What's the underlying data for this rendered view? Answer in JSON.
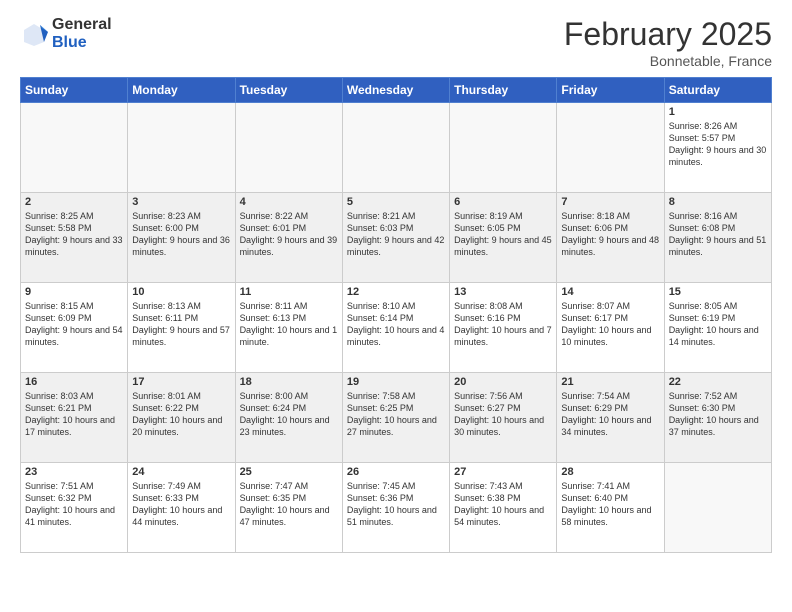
{
  "header": {
    "logo_general": "General",
    "logo_blue": "Blue",
    "month_title": "February 2025",
    "location": "Bonnetable, France"
  },
  "days_of_week": [
    "Sunday",
    "Monday",
    "Tuesday",
    "Wednesday",
    "Thursday",
    "Friday",
    "Saturday"
  ],
  "weeks": [
    [
      {
        "day": "",
        "info": ""
      },
      {
        "day": "",
        "info": ""
      },
      {
        "day": "",
        "info": ""
      },
      {
        "day": "",
        "info": ""
      },
      {
        "day": "",
        "info": ""
      },
      {
        "day": "",
        "info": ""
      },
      {
        "day": "1",
        "info": "Sunrise: 8:26 AM\nSunset: 5:57 PM\nDaylight: 9 hours and 30 minutes."
      }
    ],
    [
      {
        "day": "2",
        "info": "Sunrise: 8:25 AM\nSunset: 5:58 PM\nDaylight: 9 hours and 33 minutes."
      },
      {
        "day": "3",
        "info": "Sunrise: 8:23 AM\nSunset: 6:00 PM\nDaylight: 9 hours and 36 minutes."
      },
      {
        "day": "4",
        "info": "Sunrise: 8:22 AM\nSunset: 6:01 PM\nDaylight: 9 hours and 39 minutes."
      },
      {
        "day": "5",
        "info": "Sunrise: 8:21 AM\nSunset: 6:03 PM\nDaylight: 9 hours and 42 minutes."
      },
      {
        "day": "6",
        "info": "Sunrise: 8:19 AM\nSunset: 6:05 PM\nDaylight: 9 hours and 45 minutes."
      },
      {
        "day": "7",
        "info": "Sunrise: 8:18 AM\nSunset: 6:06 PM\nDaylight: 9 hours and 48 minutes."
      },
      {
        "day": "8",
        "info": "Sunrise: 8:16 AM\nSunset: 6:08 PM\nDaylight: 9 hours and 51 minutes."
      }
    ],
    [
      {
        "day": "9",
        "info": "Sunrise: 8:15 AM\nSunset: 6:09 PM\nDaylight: 9 hours and 54 minutes."
      },
      {
        "day": "10",
        "info": "Sunrise: 8:13 AM\nSunset: 6:11 PM\nDaylight: 9 hours and 57 minutes."
      },
      {
        "day": "11",
        "info": "Sunrise: 8:11 AM\nSunset: 6:13 PM\nDaylight: 10 hours and 1 minute."
      },
      {
        "day": "12",
        "info": "Sunrise: 8:10 AM\nSunset: 6:14 PM\nDaylight: 10 hours and 4 minutes."
      },
      {
        "day": "13",
        "info": "Sunrise: 8:08 AM\nSunset: 6:16 PM\nDaylight: 10 hours and 7 minutes."
      },
      {
        "day": "14",
        "info": "Sunrise: 8:07 AM\nSunset: 6:17 PM\nDaylight: 10 hours and 10 minutes."
      },
      {
        "day": "15",
        "info": "Sunrise: 8:05 AM\nSunset: 6:19 PM\nDaylight: 10 hours and 14 minutes."
      }
    ],
    [
      {
        "day": "16",
        "info": "Sunrise: 8:03 AM\nSunset: 6:21 PM\nDaylight: 10 hours and 17 minutes."
      },
      {
        "day": "17",
        "info": "Sunrise: 8:01 AM\nSunset: 6:22 PM\nDaylight: 10 hours and 20 minutes."
      },
      {
        "day": "18",
        "info": "Sunrise: 8:00 AM\nSunset: 6:24 PM\nDaylight: 10 hours and 23 minutes."
      },
      {
        "day": "19",
        "info": "Sunrise: 7:58 AM\nSunset: 6:25 PM\nDaylight: 10 hours and 27 minutes."
      },
      {
        "day": "20",
        "info": "Sunrise: 7:56 AM\nSunset: 6:27 PM\nDaylight: 10 hours and 30 minutes."
      },
      {
        "day": "21",
        "info": "Sunrise: 7:54 AM\nSunset: 6:29 PM\nDaylight: 10 hours and 34 minutes."
      },
      {
        "day": "22",
        "info": "Sunrise: 7:52 AM\nSunset: 6:30 PM\nDaylight: 10 hours and 37 minutes."
      }
    ],
    [
      {
        "day": "23",
        "info": "Sunrise: 7:51 AM\nSunset: 6:32 PM\nDaylight: 10 hours and 41 minutes."
      },
      {
        "day": "24",
        "info": "Sunrise: 7:49 AM\nSunset: 6:33 PM\nDaylight: 10 hours and 44 minutes."
      },
      {
        "day": "25",
        "info": "Sunrise: 7:47 AM\nSunset: 6:35 PM\nDaylight: 10 hours and 47 minutes."
      },
      {
        "day": "26",
        "info": "Sunrise: 7:45 AM\nSunset: 6:36 PM\nDaylight: 10 hours and 51 minutes."
      },
      {
        "day": "27",
        "info": "Sunrise: 7:43 AM\nSunset: 6:38 PM\nDaylight: 10 hours and 54 minutes."
      },
      {
        "day": "28",
        "info": "Sunrise: 7:41 AM\nSunset: 6:40 PM\nDaylight: 10 hours and 58 minutes."
      },
      {
        "day": "",
        "info": ""
      }
    ]
  ]
}
